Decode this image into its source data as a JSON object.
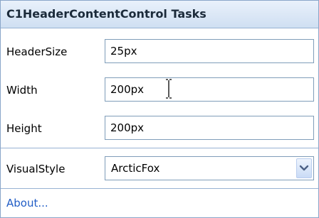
{
  "panel": {
    "title": "C1HeaderContentControl Tasks"
  },
  "fields": {
    "header_size": {
      "label": "HeaderSize",
      "value": "25px"
    },
    "width": {
      "label": "Width",
      "value": "200px"
    },
    "height": {
      "label": "Height",
      "value": "200px"
    }
  },
  "visual_style": {
    "label": "VisualStyle",
    "selected": "ArcticFox",
    "icon": "chevron-down-icon"
  },
  "footer": {
    "about_label": "About..."
  },
  "colors": {
    "title_bg": "#cfdff2",
    "border": "#7f9db9",
    "link": "#215dc6"
  }
}
